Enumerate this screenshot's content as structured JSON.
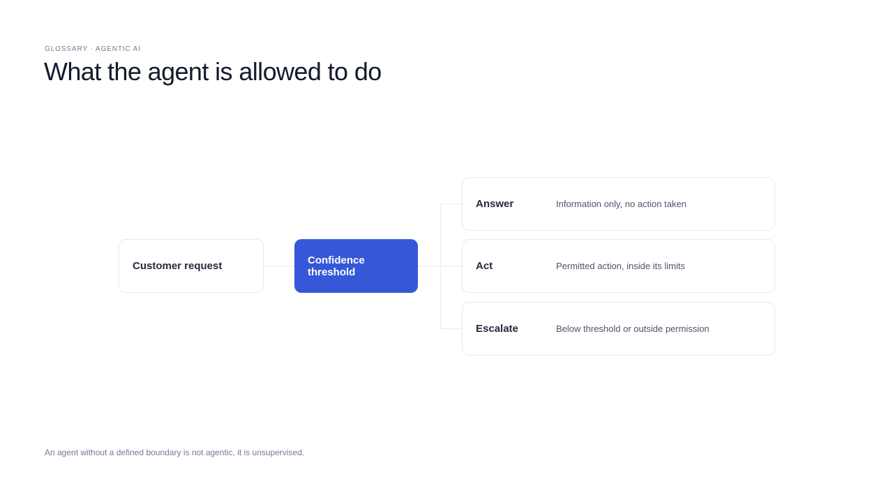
{
  "header": {
    "eyebrow": "GLOSSARY · AGENTIC AI",
    "title": "What the agent is allowed to do"
  },
  "diagram": {
    "input_node": "Customer request",
    "decision_node": "Confidence threshold",
    "outcomes": [
      {
        "name": "Answer",
        "description": "Information only, no action taken"
      },
      {
        "name": "Act",
        "description": "Permitted action, inside its limits"
      },
      {
        "name": "Escalate",
        "description": "Below threshold or outside permission"
      }
    ]
  },
  "footer": {
    "note": "An agent without a defined boundary is not agentic, it is unsupervised."
  },
  "colors": {
    "accent": "#3658d8",
    "border": "#e6e9ef",
    "connector": "#e9ecf1"
  }
}
